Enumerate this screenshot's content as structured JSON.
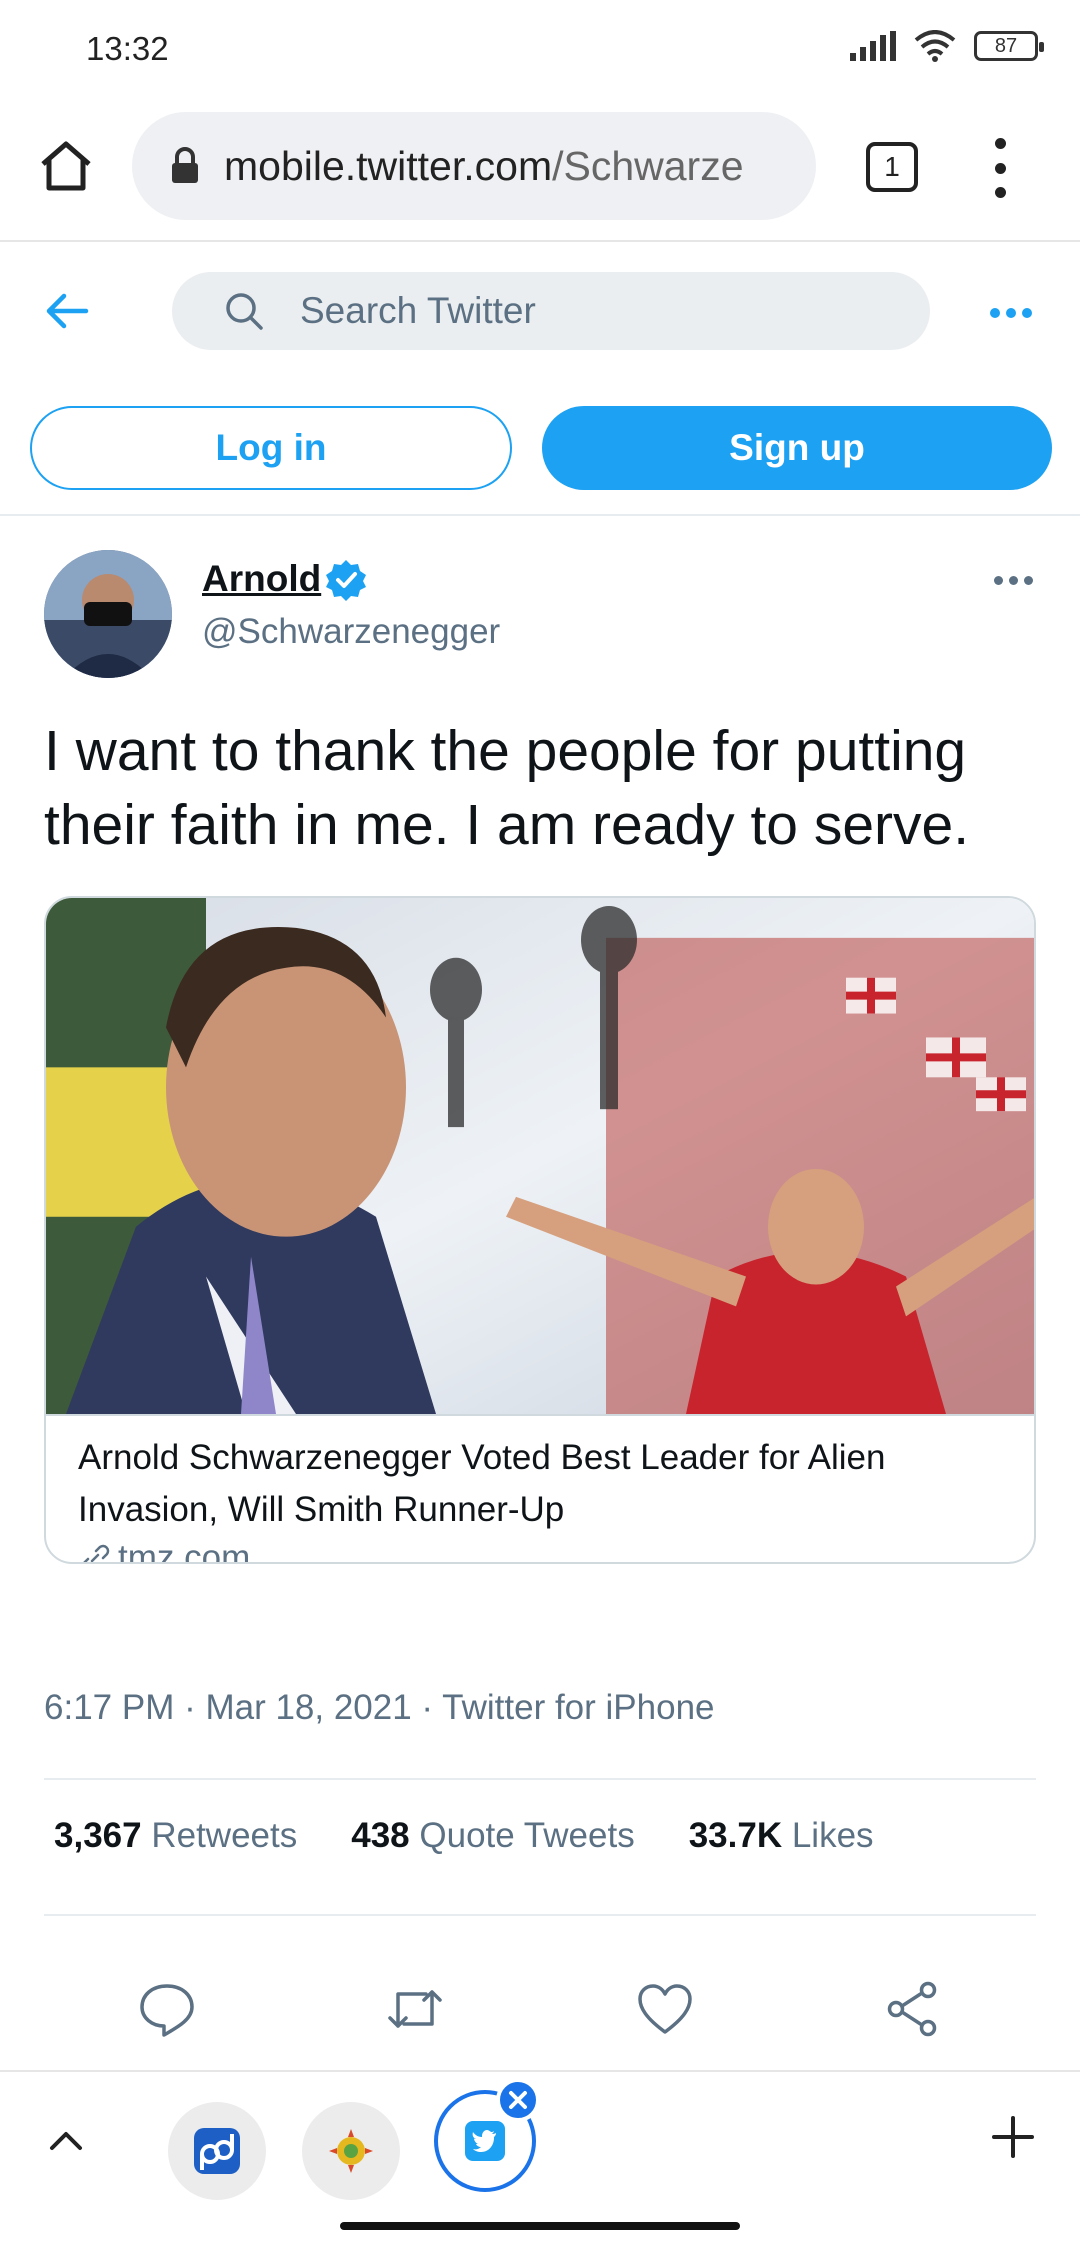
{
  "status_bar": {
    "time": "13:32",
    "battery": "87"
  },
  "browser": {
    "url_host": "mobile.twitter.com",
    "url_path": "/Schwarze",
    "tab_count": "1"
  },
  "twitter_header": {
    "search_placeholder": "Search Twitter"
  },
  "auth": {
    "login_label": "Log in",
    "signup_label": "Sign up"
  },
  "tweet": {
    "author_name": "Arnold",
    "author_handle": "@Schwarzenegger",
    "text": "I want to thank the people for putting their faith in me. I am ready to serve.",
    "card": {
      "title": "Arnold Schwarzenegger Voted Best Leader for Alien Invasion, Will Smith Runner-Up",
      "domain": "tmz.com"
    },
    "meta": "6:17 PM · Mar 18, 2021 · Twitter for iPhone",
    "stats": {
      "retweets_count": "3,367",
      "retweets_label": "Retweets",
      "quotes_count": "438",
      "quotes_label": "Quote Tweets",
      "likes_count": "33.7K",
      "likes_label": "Likes"
    }
  },
  "colors": {
    "twitter_blue": "#1da1f2",
    "chrome_blue": "#1a73e8",
    "secondary_text": "#5b7083"
  },
  "icons": [
    "home-icon",
    "lock-icon",
    "back-arrow-icon",
    "search-icon",
    "verified-badge-icon",
    "reply-icon",
    "retweet-icon",
    "like-icon",
    "share-icon",
    "chevron-up-icon",
    "plus-icon",
    "link-icon"
  ]
}
